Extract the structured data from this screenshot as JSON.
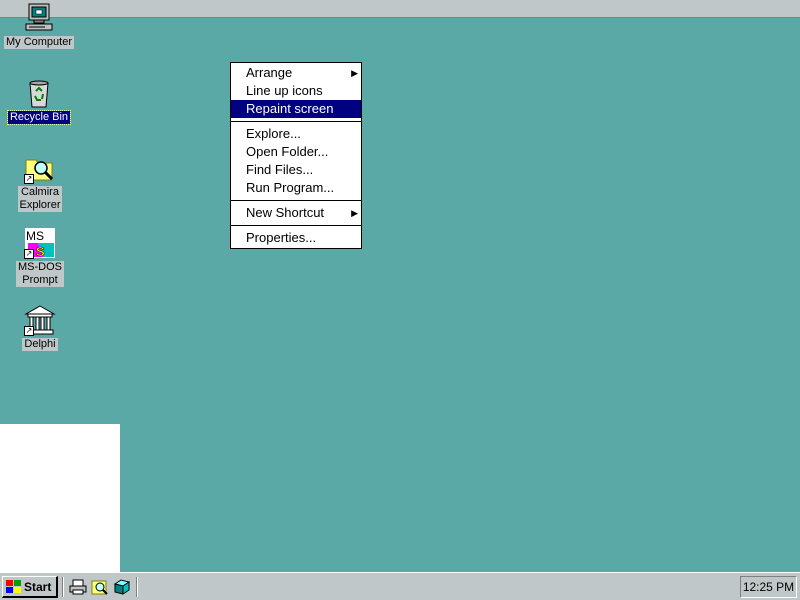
{
  "desktop": {
    "background_color": "#5aa9a6",
    "icons": [
      {
        "label": "My Computer",
        "icon": "computer-icon"
      },
      {
        "label": "Recycle Bin",
        "icon": "recycle-bin-icon",
        "selected": true
      },
      {
        "label": "Calmira\nExplorer",
        "icon": "explorer-icon"
      },
      {
        "label": "MS-DOS\nPrompt",
        "icon": "ms-dos-icon"
      },
      {
        "label": "Delphi",
        "icon": "delphi-icon"
      }
    ]
  },
  "context_menu": {
    "items": [
      {
        "label": "Arrange",
        "submenu": true
      },
      {
        "label": "Line up icons"
      },
      {
        "label": "Repaint screen",
        "highlighted": true
      },
      {
        "label": "Explore..."
      },
      {
        "label": "Open Folder..."
      },
      {
        "label": "Find Files..."
      },
      {
        "label": "Run Program..."
      },
      {
        "label": "New Shortcut",
        "submenu": true
      },
      {
        "label": "Properties..."
      }
    ]
  },
  "taskbar": {
    "start_label": "Start",
    "quick_launch": [
      "printer-icon",
      "find-icon",
      "explorer-quick-icon"
    ],
    "clock": "12:25 PM"
  },
  "colors": {
    "highlight": "#000080",
    "chrome": "#c0c7c8"
  }
}
